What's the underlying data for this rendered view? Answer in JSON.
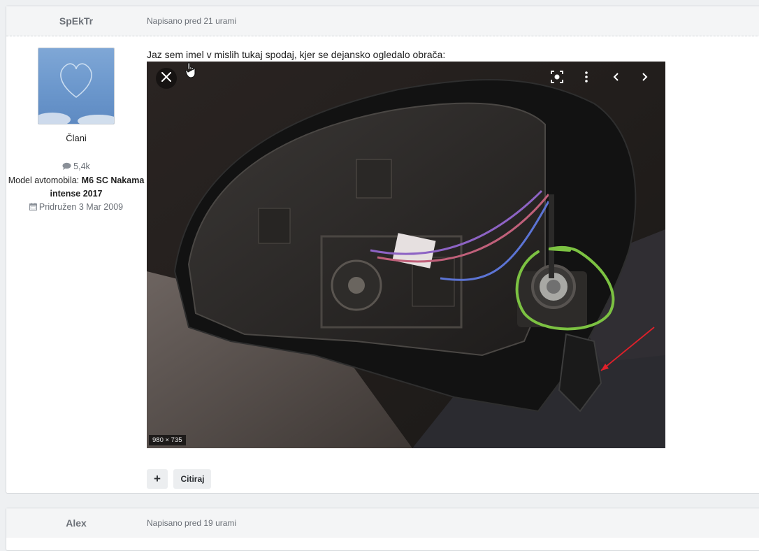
{
  "post1": {
    "author": "SpEkTr",
    "date": "Napisano pred 21 urami",
    "group": "Člani",
    "post_count": "5,4k",
    "model_label": "Model avtomobila:",
    "model_value": "M6 SC Nakama intense 2017",
    "joined": "Pridružen 3 Mar 2009",
    "text": "Jaz sem imel v mislih tukaj spodaj, kjer se dejansko ogledalo obrača:",
    "image_dimensions": "980 × 735",
    "quote_label": "Citiraj",
    "plus_label": "+"
  },
  "post2": {
    "author": "Alex",
    "date": "Napisano pred 19 urami"
  },
  "icons": {
    "comment": "comment-icon",
    "calendar": "calendar-icon",
    "close": "close-icon",
    "lens": "lens-search-icon",
    "more": "more-vertical-icon",
    "prev": "chevron-left-icon",
    "next": "chevron-right-icon",
    "cursor": "hand-cursor-icon"
  },
  "colors": {
    "header_bg": "#f4f5f6",
    "muted_text": "#6b7077",
    "green_annotation": "#7cc242",
    "red_arrow": "#e0202a"
  }
}
